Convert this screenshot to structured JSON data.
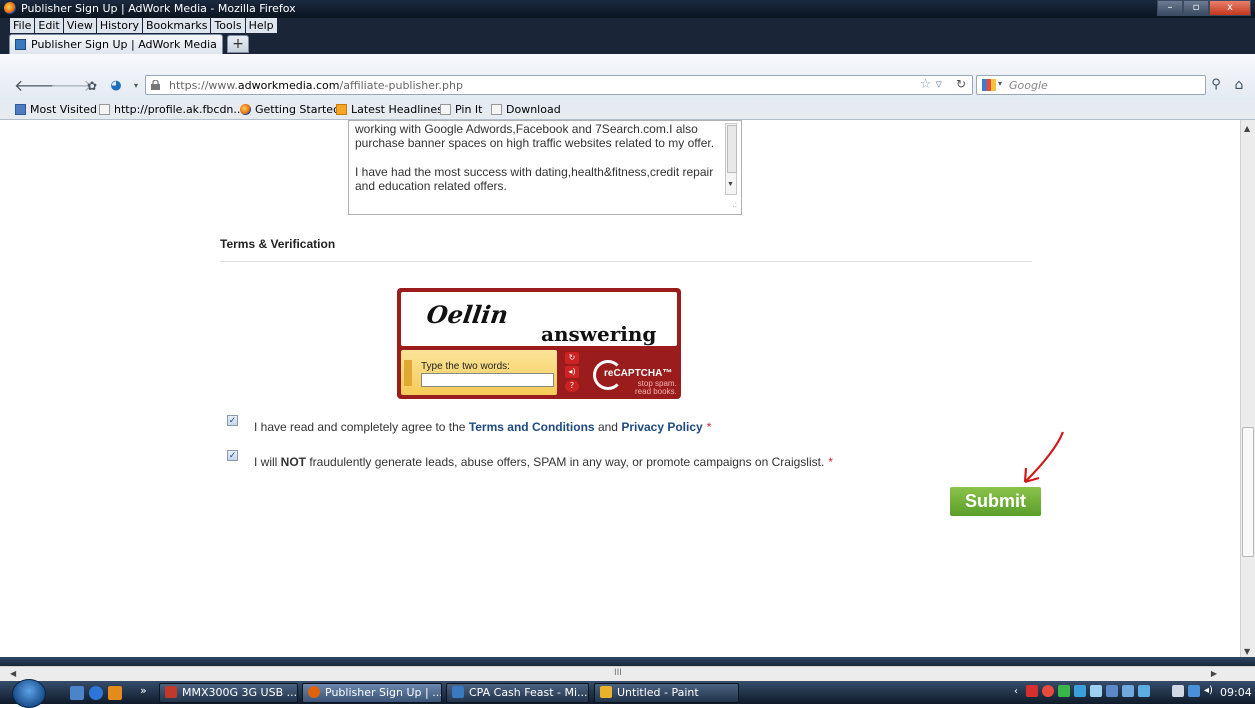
{
  "window": {
    "title": "Publisher Sign Up | AdWork Media - Mozilla Firefox"
  },
  "menu": [
    "File",
    "Edit",
    "View",
    "History",
    "Bookmarks",
    "Tools",
    "Help"
  ],
  "tabs": [
    {
      "label": "Publisher Sign Up | AdWork Media"
    }
  ],
  "newtab_label": "+",
  "navbar": {
    "url_prefix": "https://www.",
    "url_domain": "adworkmedia.com",
    "url_path": "/affiliate-publisher.php",
    "search_placeholder": "Google"
  },
  "bookmarks": [
    {
      "label": "Most Visited",
      "icon": "most-visited-icon"
    },
    {
      "label": "http://profile.ak.fbcdn...",
      "icon": "page-icon"
    },
    {
      "label": "Getting Started",
      "icon": "firefox-icon"
    },
    {
      "label": "Latest Headlines",
      "icon": "rss-icon"
    },
    {
      "label": "Pin It",
      "icon": "page-icon"
    },
    {
      "label": "Download",
      "icon": "page-icon"
    }
  ],
  "form": {
    "textarea_lines": [
      "working with Google Adwords,Facebook and 7Search.com.I also",
      "purchase banner spaces on high traffic websites related to my offer.",
      "",
      "I have had the most success with dating,health&fitness,credit repair",
      "and education related offers."
    ],
    "section_title": "Terms & Verification",
    "captcha": {
      "word1": "Oellin",
      "word2": "answering",
      "prompt": "Type the two words:",
      "brand": "reCAPTCHA™",
      "tagline1": "stop spam.",
      "tagline2": "read books."
    },
    "agree1": {
      "pre": "I have read and completely agree to the ",
      "link1": "Terms and Conditions",
      "mid": " and ",
      "link2": "Privacy Policy",
      "req": "*",
      "checked": true
    },
    "agree2": {
      "pre": "I will ",
      "bold": "NOT",
      "post": " fraudulently generate leads, abuse offers, SPAM in any way, or promote campaigns on Craigslist.",
      "req": "*",
      "checked": true
    },
    "submit_label": "Submit"
  },
  "taskbar": {
    "items": [
      {
        "label": "MMX300G 3G USB ...",
        "color": "#c0392b"
      },
      {
        "label": "Publisher Sign Up | ...",
        "color": "#e2620c"
      },
      {
        "label": "CPA Cash Feast - Mi...",
        "color": "#3a78c0"
      },
      {
        "label": "Untitled - Paint",
        "color": "#e6b32a"
      }
    ],
    "more": "»",
    "clock": "09:04"
  },
  "colors": {
    "submit": "#6cb333",
    "captcha": "#9b1c1c",
    "link": "#1e4a7e"
  }
}
